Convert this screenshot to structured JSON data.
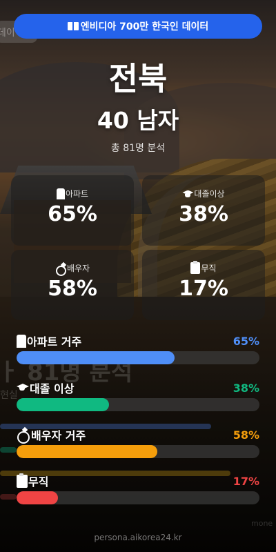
{
  "badge": {
    "icon": "book-icon",
    "text": "엔비디아 700만 한국인 데이터",
    "color": "#2563eb"
  },
  "region": "전북",
  "persona": "40 남자",
  "total": "총 81명 분석",
  "cards": [
    {
      "icon": "apartment-icon",
      "label": "아파트",
      "value": "65%"
    },
    {
      "icon": "graduation-cap-icon",
      "label": "대졸이상",
      "value": "38%"
    },
    {
      "icon": "ring-icon",
      "label": "배우자",
      "value": "58%"
    },
    {
      "icon": "clipboard-icon",
      "label": "무직",
      "value": "17%"
    }
  ],
  "stats": [
    {
      "icon": "apartment-icon",
      "label": "아파트 거주",
      "value": "65%",
      "fraction": 0.65,
      "color": "#4f8ef7"
    },
    {
      "icon": "graduation-cap-icon",
      "label": "대졸 이상",
      "value": "38%",
      "fraction": 0.38,
      "color": "#10b981"
    },
    {
      "icon": "ring-icon",
      "label": "배우자 거주",
      "value": "58%",
      "fraction": 0.58,
      "color": "#f59e0b"
    },
    {
      "icon": "clipboard-icon",
      "label": "무직",
      "value": "17%",
      "fraction": 0.17,
      "color": "#ef4444"
    }
  ],
  "footer": "persona.aikorea24.kr"
}
